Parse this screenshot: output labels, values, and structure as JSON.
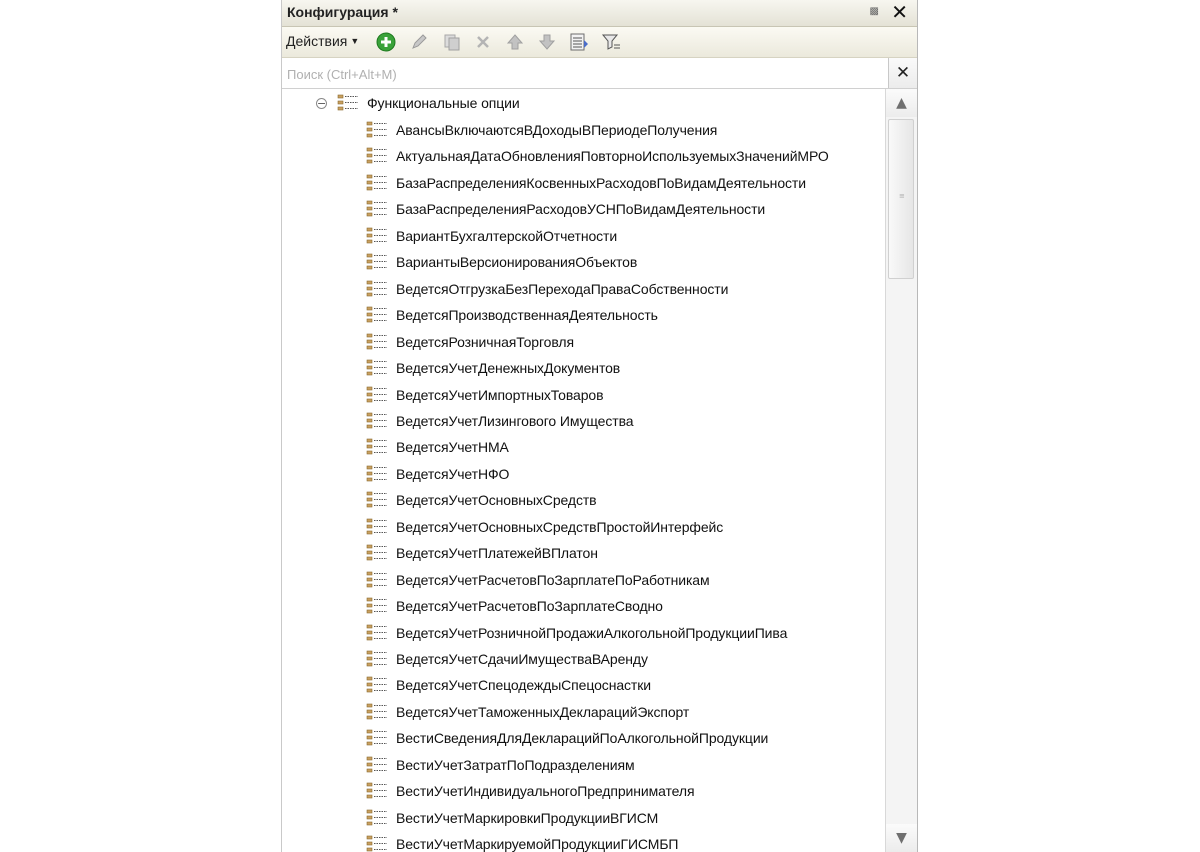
{
  "window": {
    "title": "Конфигурация *",
    "pin_icon": "pin-icon",
    "close_icon": "close-icon"
  },
  "toolbar": {
    "actions_label": "Действия",
    "buttons": [
      "add-icon",
      "edit-icon",
      "copy-icon",
      "delete-icon",
      "move-up-icon",
      "move-down-icon",
      "list-icon",
      "filter-icon"
    ]
  },
  "search": {
    "placeholder": "Поиск (Ctrl+Alt+M)",
    "value": ""
  },
  "tree": {
    "root": {
      "label": "Функциональные опции",
      "expanded": true
    },
    "items": [
      "АвансыВключаютсяВДоходыВПериодеПолучения",
      "АктуальнаяДатаОбновленияПовторноИспользуемыхЗначенийМРО",
      "БазаРаспределенияКосвенныхРасходовПоВидамДеятельности",
      "БазаРаспределенияРасходовУСНПоВидамДеятельности",
      "ВариантБухгалтерскойОтчетности",
      "ВариантыВерсионированияОбъектов",
      "ВедетсяОтгрузкаБезПереходаПраваСобственности",
      "ВедетсяПроизводственнаяДеятельность",
      "ВедетсяРозничнаяТорговля",
      "ВедетсяУчетДенежныхДокументов",
      "ВедетсяУчетИмпортныхТоваров",
      "ВедетсяУчетЛизингового Имущества",
      "ВедетсяУчетНМА",
      "ВедетсяУчетНФО",
      "ВедетсяУчетОсновныхСредств",
      "ВедетсяУчетОсновныхСредствПростойИнтерфейс",
      "ВедетсяУчетПлатежейВПлатон",
      "ВедетсяУчетРасчетовПоЗарплатеПоРаботникам",
      "ВедетсяУчетРасчетовПоЗарплатеСводно",
      "ВедетсяУчетРозничнойПродажиАлкогольнойПродукцииПива",
      "ВедетсяУчетСдачиИмуществаВАренду",
      "ВедетсяУчетСпецодеждыСпецоснастки",
      "ВедетсяУчетТаможенныхДекларацийЭкспорт",
      "ВестиСведенияДляДекларацийПоАлкогольнойПродукции",
      "ВестиУчетЗатратПоПодразделениям",
      "ВестиУчетИндивидуальногоПредпринимателя",
      "ВестиУчетМаркировкиПродукцииВГИСМ",
      "ВестиУчетМаркируемойПродукцииГИСМБП"
    ]
  },
  "colors": {
    "icon_orange": "#c9a060",
    "add_green": "#3aa23a"
  }
}
